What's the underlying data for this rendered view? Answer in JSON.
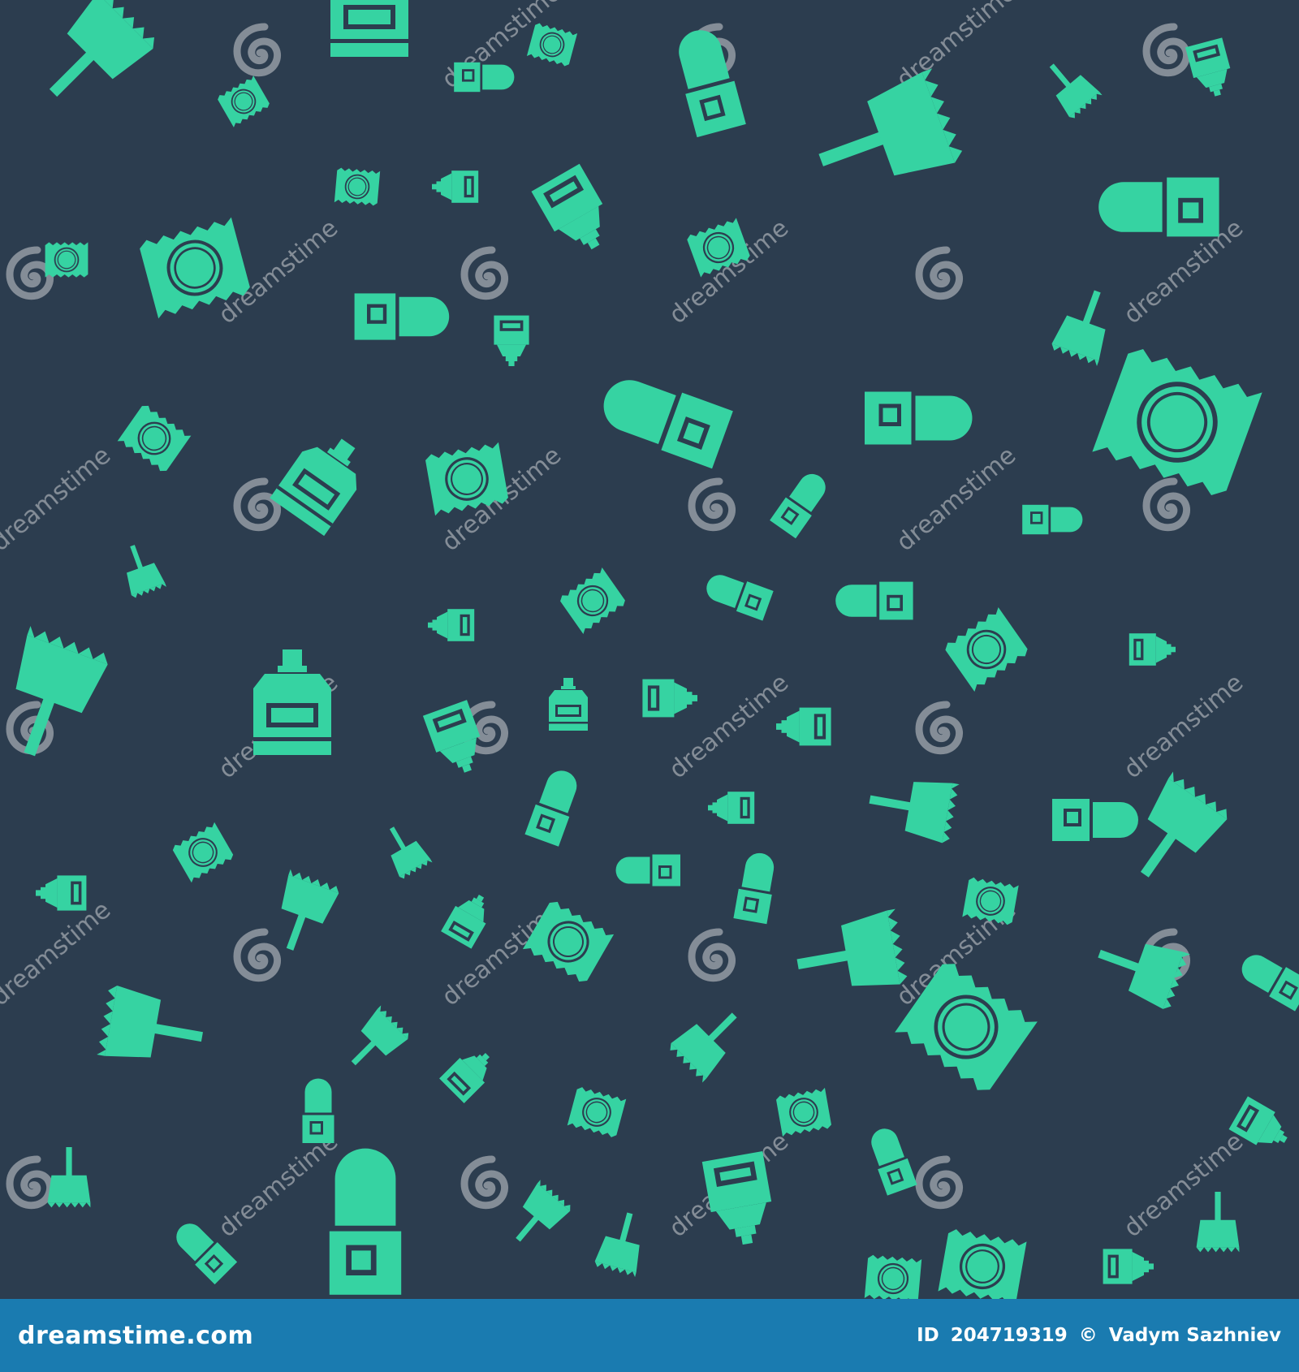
{
  "image": {
    "background_color": "#2c3d4f",
    "icon_color": "#36d3a2",
    "watermark_color": "#8f97a0",
    "icon_names": [
      "condom-packet-icon",
      "roll-on-deodorant-icon",
      "mouthwash-bottle-icon",
      "hair-dye-brush-icon",
      "ointment-tube-icon"
    ]
  },
  "watermark": {
    "text": "dreamstime",
    "logo": "spiral-logo"
  },
  "footer": {
    "brand": "dreamstime.com",
    "id_label": "ID",
    "id_value": "204719319",
    "copyright_symbol": "©",
    "author": "Vadym Sazhniev",
    "background_color": "#1a7bb0"
  }
}
